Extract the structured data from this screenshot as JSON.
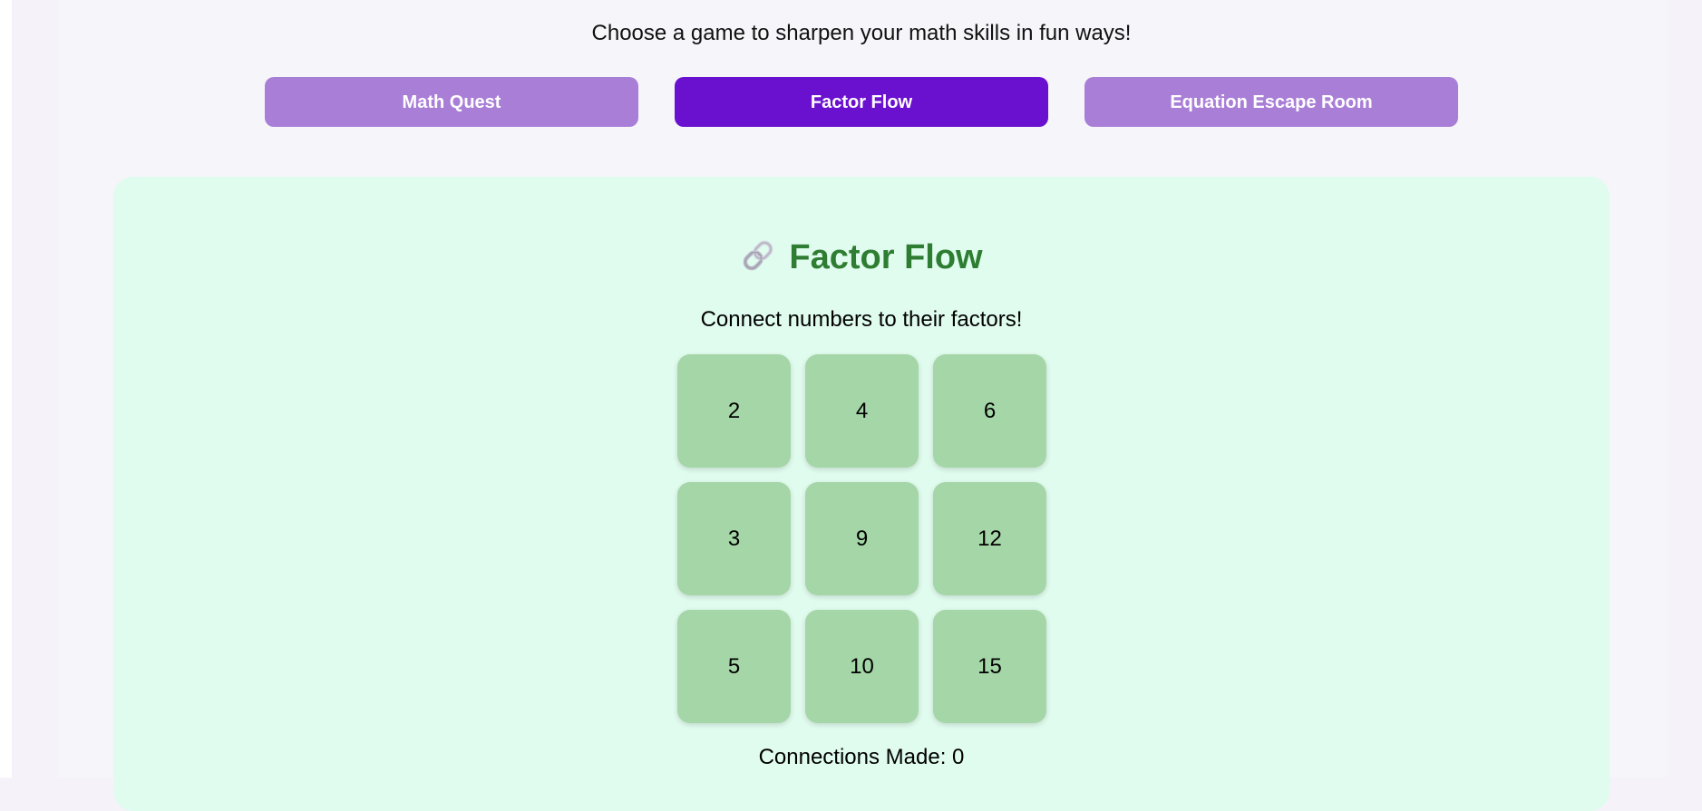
{
  "header": {
    "tagline": "Choose a game to sharpen your math skills in fun ways!"
  },
  "games": {
    "tabs": [
      {
        "label": "Math Quest",
        "active": false
      },
      {
        "label": "Factor Flow",
        "active": true
      },
      {
        "label": "Equation Escape Room",
        "active": false
      }
    ]
  },
  "factor_flow": {
    "icon": "link-icon",
    "title": "Factor Flow",
    "instructions": "Connect numbers to their factors!",
    "tiles": [
      "2",
      "4",
      "6",
      "3",
      "9",
      "12",
      "5",
      "10",
      "15"
    ],
    "status_label": "Connections Made: ",
    "connections_made": "0"
  },
  "colors": {
    "tab_inactive": "#a97ed7",
    "tab_active": "#6a10cf",
    "panel_background": "#e0fcee",
    "title_green": "#2e7d32",
    "tile_green": "#a5d6a7"
  }
}
